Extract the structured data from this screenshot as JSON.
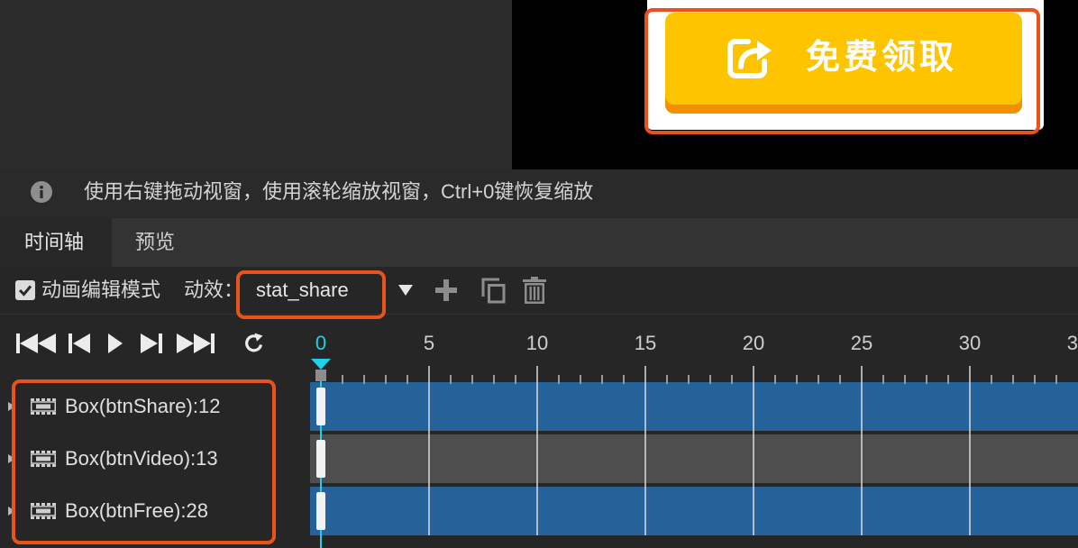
{
  "scene": {
    "cta_button": {
      "label": "免费领取",
      "icon": "share-icon"
    }
  },
  "hint": {
    "icon": "info-icon",
    "text": "使用右键拖动视窗，使用滚轮缩放视窗，Ctrl+0键恢复缩放"
  },
  "tabs": [
    {
      "label": "时间轴",
      "active": true
    },
    {
      "label": "预览",
      "active": false
    }
  ],
  "toolbar": {
    "edit_mode": {
      "label": "动画编辑模式",
      "checked": true
    },
    "effect_label": "动效：",
    "effect_select": {
      "value": "stat_share",
      "icon": "dropdown-arrow-icon"
    },
    "actions": [
      {
        "icon": "plus-icon"
      },
      {
        "icon": "copy-icon"
      },
      {
        "icon": "trash-icon"
      }
    ]
  },
  "playback": {
    "controls": [
      {
        "icon": "first-frame-icon"
      },
      {
        "icon": "prev-frame-icon"
      },
      {
        "icon": "play-icon"
      },
      {
        "icon": "next-frame-icon"
      },
      {
        "icon": "last-frame-icon"
      },
      {
        "icon": "loop-icon"
      }
    ]
  },
  "timeline": {
    "current_frame": 0,
    "ruler_labels": [
      "0",
      "5",
      "10",
      "15",
      "20",
      "25",
      "30",
      "3"
    ],
    "tracks": [
      {
        "label": "Box(btnShare):12",
        "icon": "box-node-icon",
        "keyframes": [
          0
        ],
        "color": "#25629a"
      },
      {
        "label": "Box(btnVideo):13",
        "icon": "box-node-icon",
        "keyframes": [
          0
        ],
        "color": "#4e4e4e"
      },
      {
        "label": "Box(btnFree):28",
        "icon": "box-node-icon",
        "keyframes": [
          0
        ],
        "color": "#25629a"
      }
    ]
  },
  "colors": {
    "cta_fill": "#ffc400",
    "cta_edge": "#f29100",
    "playhead": "#1cd2e8",
    "highlight": "#ea521d"
  }
}
